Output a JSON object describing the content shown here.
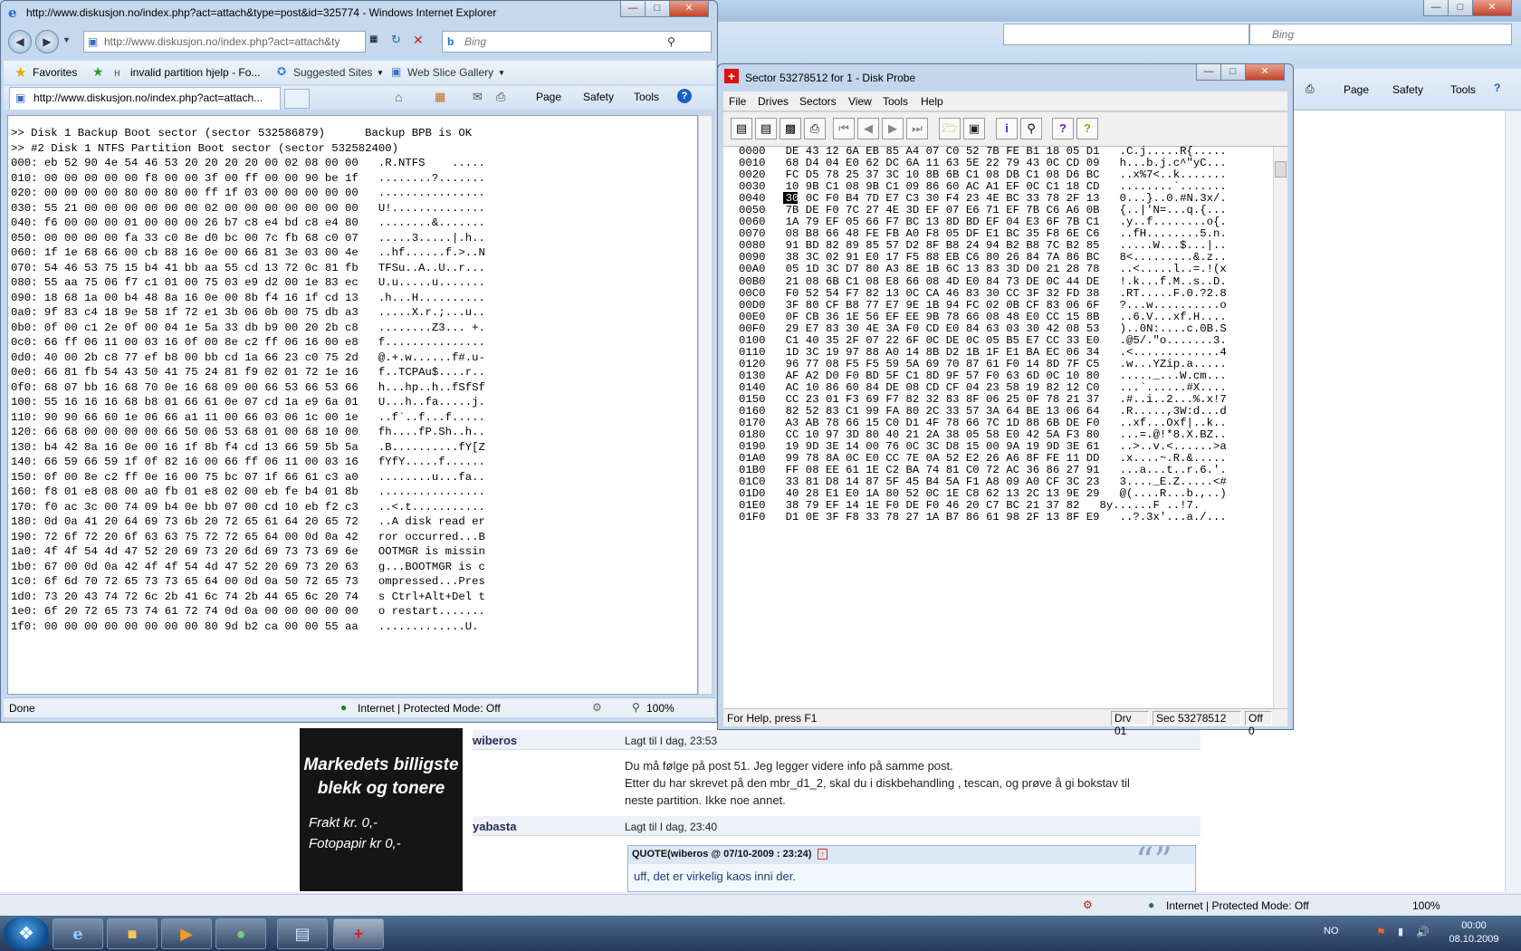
{
  "background_window": {
    "commands": [
      "Page",
      "Safety",
      "Tools"
    ],
    "search_placeholder": "Bing",
    "status": "Internet | Protected Mode: Off",
    "zoom": "100%"
  },
  "forum": {
    "ad_line1": "Markedets billigste",
    "ad_line2": "blekk og tonere",
    "ad_line3": "Frakt kr. 0,-",
    "ad_line4": "Fotopapir kr 0,-",
    "post1_user": "wiberos",
    "post1_date": "Lagt til I dag, 23:53",
    "post1_line1": "Du må følge på post 51. Jeg legger videre info på samme post.",
    "post1_line2": "Etter du har skrevet på den mbr_d1_2, skal du i diskbehandling , tescan, og prøve å gi bokstav til",
    "post1_line3": "neste partition. Ikke noe annet.",
    "post2_user": "yabasta",
    "post2_date": "Lagt til I dag, 23:40",
    "quote_header": "QUOTE(wiberos @ 07/10-2009 : 23:24)",
    "quote_text": "uff, det er virkelig kaos inni der."
  },
  "ie_window": {
    "title": "http://www.diskusjon.no/index.php?act=attach&type=post&id=325774 - Windows Internet Explorer",
    "address": "http://www.diskusjon.no/index.php?act=attach&ty",
    "search_placeholder": "Bing",
    "favorites_label": "Favorites",
    "fav_links": [
      "invalid partition hjelp - Fo...",
      "Suggested Sites",
      "Web Slice Gallery"
    ],
    "tab_label": "http://www.diskusjon.no/index.php?act=attach...",
    "commands": [
      "Page",
      "Safety",
      "Tools"
    ],
    "status_left": "Done",
    "status_zone": "Internet | Protected Mode: Off",
    "zoom": "100%",
    "content_lines": [
      ">> Disk 1 Backup Boot sector (sector 532586879)      Backup BPB is OK",
      ">> #2 Disk 1 NTFS Partition Boot sector (sector 532582400)",
      "000: eb 52 90 4e 54 46 53 20 20 20 20 00 02 08 00 00   .R.NTFS    .....",
      "010: 00 00 00 00 00 f8 00 00 3f 00 ff 00 00 90 be 1f   ........?.......",
      "020: 00 00 00 00 80 00 80 00 ff 1f 03 00 00 00 00 00   ................",
      "030: 55 21 00 00 00 00 00 00 02 00 00 00 00 00 00 00   U!..............",
      "040: f6 00 00 00 01 00 00 00 26 b7 c8 e4 bd c8 e4 80   ........&.......",
      "050: 00 00 00 00 fa 33 c0 8e d0 bc 00 7c fb 68 c0 07   .....3.....|.h..",
      "060: 1f 1e 68 66 00 cb 88 16 0e 00 66 81 3e 03 00 4e   ..hf......f.>..N",
      "070: 54 46 53 75 15 b4 41 bb aa 55 cd 13 72 0c 81 fb   TFSu..A..U..r...",
      "080: 55 aa 75 06 f7 c1 01 00 75 03 e9 d2 00 1e 83 ec   U.u.....u.......",
      "090: 18 68 1a 00 b4 48 8a 16 0e 00 8b f4 16 1f cd 13   .h...H..........",
      "0a0: 9f 83 c4 18 9e 58 1f 72 e1 3b 06 0b 00 75 db a3   .....X.r.;...u..",
      "0b0: 0f 00 c1 2e 0f 00 04 1e 5a 33 db b9 00 20 2b c8   ........Z3... +.",
      "0c0: 66 ff 06 11 00 03 16 0f 00 8e c2 ff 06 16 00 e8   f...............",
      "0d0: 40 00 2b c8 77 ef b8 00 bb cd 1a 66 23 c0 75 2d   @.+.w......f#.u-",
      "0e0: 66 81 fb 54 43 50 41 75 24 81 f9 02 01 72 1e 16   f..TCPAu$....r..",
      "0f0: 68 07 bb 16 68 70 0e 16 68 09 00 66 53 66 53 66   h...hp..h..fSfSf",
      "100: 55 16 16 16 68 b8 01 66 61 0e 07 cd 1a e9 6a 01   U...h..fa.....j.",
      "110: 90 90 66 60 1e 06 66 a1 11 00 66 03 06 1c 00 1e   ..f`..f...f.....",
      "120: 66 68 00 00 00 00 66 50 06 53 68 01 00 68 10 00   fh....fP.Sh..h..",
      "130: b4 42 8a 16 0e 00 16 1f 8b f4 cd 13 66 59 5b 5a   .B..........fY[Z",
      "140: 66 59 66 59 1f 0f 82 16 00 66 ff 06 11 00 03 16   fYfY.....f......",
      "150: 0f 00 8e c2 ff 0e 16 00 75 bc 07 1f 66 61 c3 a0   ........u...fa..",
      "160: f8 01 e8 08 00 a0 fb 01 e8 02 00 eb fe b4 01 8b   ................",
      "170: f0 ac 3c 00 74 09 b4 0e bb 07 00 cd 10 eb f2 c3   ..<.t...........",
      "180: 0d 0a 41 20 64 69 73 6b 20 72 65 61 64 20 65 72   ..A disk read er",
      "190: 72 6f 72 20 6f 63 63 75 72 72 65 64 00 0d 0a 42   ror occurred...B",
      "1a0: 4f 4f 54 4d 47 52 20 69 73 20 6d 69 73 73 69 6e   OOTMGR is missin",
      "1b0: 67 00 0d 0a 42 4f 4f 54 4d 47 52 20 69 73 20 63   g...BOOTMGR is c",
      "1c0: 6f 6d 70 72 65 73 73 65 64 00 0d 0a 50 72 65 73   ompressed...Pres",
      "1d0: 73 20 43 74 72 6c 2b 41 6c 74 2b 44 65 6c 20 74   s Ctrl+Alt+Del t",
      "1e0: 6f 20 72 65 73 74 61 72 74 0d 0a 00 00 00 00 00   o restart.......",
      "1f0: 00 00 00 00 00 00 00 00 80 9d b2 ca 00 00 55 aa   .............U."
    ]
  },
  "disk_probe": {
    "title": "Sector 53278512 for 1 - Disk Probe",
    "menu": [
      "File",
      "Drives",
      "Sectors",
      "View",
      "Tools",
      "Help"
    ],
    "status_help": "For Help, press F1",
    "status_drive": "Drv  01",
    "status_sector": "Sec 53278512",
    "status_offset": "Off 0",
    "rows": [
      {
        "off": "0000",
        "hex": "DE 43 12 6A EB 85 A4 07 C0 52 7B FE B1 18 05 D1",
        "asc": ".C.j.....R{....."
      },
      {
        "off": "0010",
        "hex": "68 D4 04 E0 62 DC 6A 11 63 5E 22 79 43 0C CD 09",
        "asc": "h...b.j.c^\"yC..."
      },
      {
        "off": "0020",
        "hex": "FC D5 78 25 37 3C 10 8B 6B C1 08 DB C1 08 D6 BC",
        "asc": "..x%7<..k......."
      },
      {
        "off": "0030",
        "hex": "10 9B C1 08 9B C1 09 86 60 AC A1 EF 0C C1 18 CD",
        "asc": "........`......."
      },
      {
        "off": "0040",
        "hex": "30 0C F0 B4 7D E7 C3 30 F4 23 4E BC 33 78 2F 13",
        "asc": "0...}..0.#N.3x/."
      },
      {
        "off": "0050",
        "hex": "7B DE F0 7C 27 4E 3D EF 07 E6 71 EF 7B C6 A6 0B",
        "asc": "{..|'N=...q.{..."
      },
      {
        "off": "0060",
        "hex": "1A 79 EF 05 66 F7 BC 13 8D BD EF 04 E3 6F 7B C1",
        "asc": ".y..f........o{."
      },
      {
        "off": "0070",
        "hex": "08 B8 66 48 FE FB A0 F8 05 DF E1 BC 35 F8 6E C6",
        "asc": "..fH........5.n."
      },
      {
        "off": "0080",
        "hex": "91 BD 82 89 85 57 D2 8F B8 24 94 B2 B8 7C B2 85",
        "asc": ".....W...$...|.."
      },
      {
        "off": "0090",
        "hex": "38 3C 02 91 E0 17 F5 88 EB C6 80 26 84 7A 86 BC",
        "asc": "8<.........&.z.."
      },
      {
        "off": "00A0",
        "hex": "05 1D 3C D7 80 A3 8E 1B 6C 13 83 3D D0 21 28 78",
        "asc": "..<.....l..=.!(x"
      },
      {
        "off": "00B0",
        "hex": "21 08 6B C1 08 E8 66 08 4D E0 84 73 DE 0C 44 DE",
        "asc": "!.k...f.M..s..D."
      },
      {
        "off": "00C0",
        "hex": "F0 52 54 F7 82 13 0C CA 46 83 30 CC 3F 32 FD 38",
        "asc": ".RT.....F.0.?2.8"
      },
      {
        "off": "00D0",
        "hex": "3F 80 CF B8 77 E7 9E 1B 94 FC 02 0B CF 83 06 6F",
        "asc": "?...w..........o"
      },
      {
        "off": "00E0",
        "hex": "0F CB 36 1E 56 EF EE 9B 78 66 08 48 E0 CC 15 8B",
        "asc": "..6.V...xf.H...."
      },
      {
        "off": "00F0",
        "hex": "29 E7 83 30 4E 3A F0 CD E0 84 63 03 30 42 08 53",
        "asc": ")..0N:....c.0B.S"
      },
      {
        "off": "0100",
        "hex": "C1 40 35 2F 07 22 6F 0C DE 0C 05 B5 E7 CC 33 E0",
        "asc": ".@5/.\"o.......3."
      },
      {
        "off": "0110",
        "hex": "1D 3C 19 97 88 A0 14 8B D2 1B 1F E1 BA EC 06 34",
        "asc": ".<.............4"
      },
      {
        "off": "0120",
        "hex": "96 77 08 F5 F5 59 5A 69 70 87 61 F0 14 8D 7F C5",
        "asc": ".w...YZip.a....."
      },
      {
        "off": "0130",
        "hex": "AF A2 D0 F0 BD 5F C1 8D 9F 57 F0 63 6D 0C 10 80",
        "asc": "....._...W.cm..."
      },
      {
        "off": "0140",
        "hex": "AC 10 86 60 84 DE 08 CD CF 04 23 58 19 82 12 C0",
        "asc": "...`......#X...."
      },
      {
        "off": "0150",
        "hex": "CC 23 01 F3 69 F7 82 32 83 8F 06 25 0F 78 21 37",
        "asc": ".#..i..2...%.x!7"
      },
      {
        "off": "0160",
        "hex": "82 52 83 C1 99 FA 80 2C 33 57 3A 64 BE 13 06 64",
        "asc": ".R.....,3W:d...d"
      },
      {
        "off": "0170",
        "hex": "A3 AB 78 66 15 C0 D1 4F 78 66 7C 1D 88 6B DE F0",
        "asc": "..xf...Oxf|..k.."
      },
      {
        "off": "0180",
        "hex": "CC 10 97 3D 80 40 21 2A 38 05 58 E0 42 5A F3 80",
        "asc": "...=.@!*8.X.BZ.."
      },
      {
        "off": "0190",
        "hex": "19 9D 3E 14 00 76 0C 3C D8 15 00 9A 19 9D 3E 61",
        "asc": "..>..v.<......>a"
      },
      {
        "off": "01A0",
        "hex": "99 78 8A 0C E0 CC 7E 0A 52 E2 26 A6 8F FE 11 DD",
        "asc": ".x....~.R.&....."
      },
      {
        "off": "01B0",
        "hex": "FF 08 EE 61 1E C2 BA 74 81 C0 72 AC 36 86 27 91",
        "asc": "...a...t..r.6.'."
      },
      {
        "off": "01C0",
        "hex": "33 81 D8 14 87 5F 45 B4 5A F1 A8 09 A0 CF 3C 23",
        "asc": "3...._E.Z.....<#"
      },
      {
        "off": "01D0",
        "hex": "40 28 E1 E0 1A 80 52 0C 1E C8 62 13 2C 13 9E 29",
        "asc": "@(....R...b.,..)"
      },
      {
        "off": "01E0",
        "hex": "38 79 EF 14 1E F0 DE F0 46 20 C7 BC 21 37 82",
        "asc": "8y......F ..!7."
      },
      {
        "off": "01F0",
        "hex": "D1 0E 3F F8 33 78 27 1A B7 86 61 98 2F 13 8F E9",
        "asc": "..?.3x'...a./..."
      }
    ]
  },
  "taskbar": {
    "lang": "NO",
    "time": "00:00",
    "date": "08.10.2009"
  }
}
